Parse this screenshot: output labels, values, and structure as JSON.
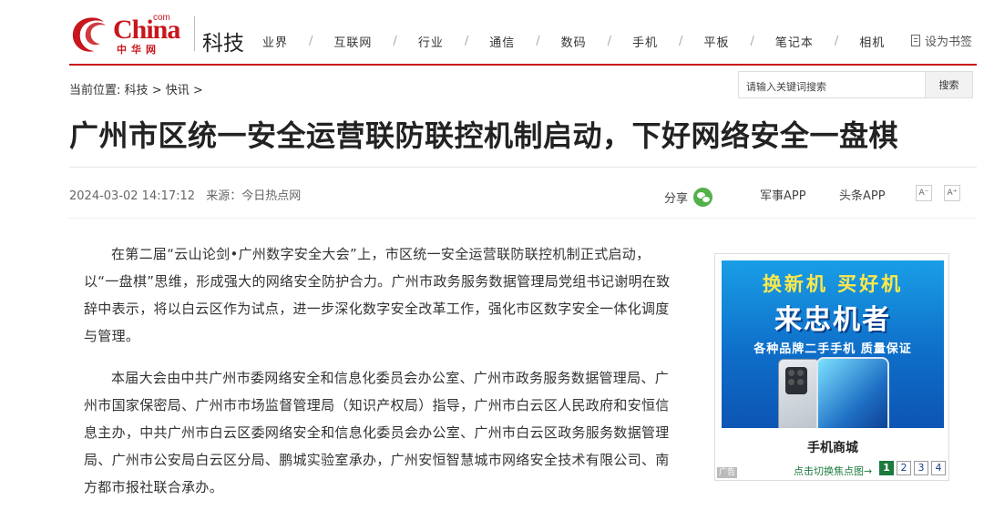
{
  "header": {
    "logo_text": "China",
    "logo_com": "com",
    "logo_cn": "中华网",
    "channel": "科技",
    "nav": [
      "业界",
      "互联网",
      "行业",
      "通信",
      "数码",
      "手机",
      "平板",
      "笔记本",
      "相机"
    ],
    "nav_separator": "/",
    "bookmark_label": "设为书签"
  },
  "breadcrumb": {
    "prefix": "当前位置:",
    "items": [
      "科技",
      "快讯"
    ],
    "separator": ">"
  },
  "search": {
    "placeholder": "请输入关键词搜索",
    "button_label": "搜索"
  },
  "article": {
    "title": "广州市区统一安全运营联防联控机制启动，下好网络安全一盘棋",
    "datetime": "2024-03-02 14:17:12",
    "source": "来源：今日热点网",
    "share_label": "分享",
    "apps": [
      "军事APP",
      "头条APP"
    ],
    "font_smaller": "A⁻",
    "font_larger": "A⁺",
    "paragraphs": [
      "在第二届“云山论剑•广州数字安全大会”上，市区统一安全运营联防联控机制正式启动，以“一盘棋”思维，形成强大的网络安全防护合力。广州市政务服务数据管理局党组书记谢明在致辞中表示，将以白云区作为试点，进一步深化数字安全改革工作，强化市区数字安全一体化调度与管理。",
      "本届大会由中共广州市委网络安全和信息化委员会办公室、广州市政务服务数据管理局、广州市国家保密局、广州市市场监督管理局（知识产权局）指导，广州市白云区人民政府和安恒信息主办，中共广州市白云区委网络安全和信息化委员会办公室、广州市白云区政务服务数据管理局、广州市公安局白云区分局、鹏城实验室承办，广州安恒智慧城市网络安全技术有限公司、南方都市报社联合承办。"
    ]
  },
  "ad": {
    "line1": "换新机 买好机",
    "line2": "来忠机者",
    "line3": "各种品牌二手手机 质量保证",
    "name": "手机商城",
    "tag": "广告",
    "switch_label": "点击切换焦点图→",
    "pages": [
      "1",
      "2",
      "3",
      "4"
    ],
    "active_page": 1
  },
  "colors": {
    "brand_red": "#c8161d",
    "ad_blue": "#0e6ec9",
    "ad_green": "#1c7a3d",
    "wechat_green": "#52b14a"
  }
}
